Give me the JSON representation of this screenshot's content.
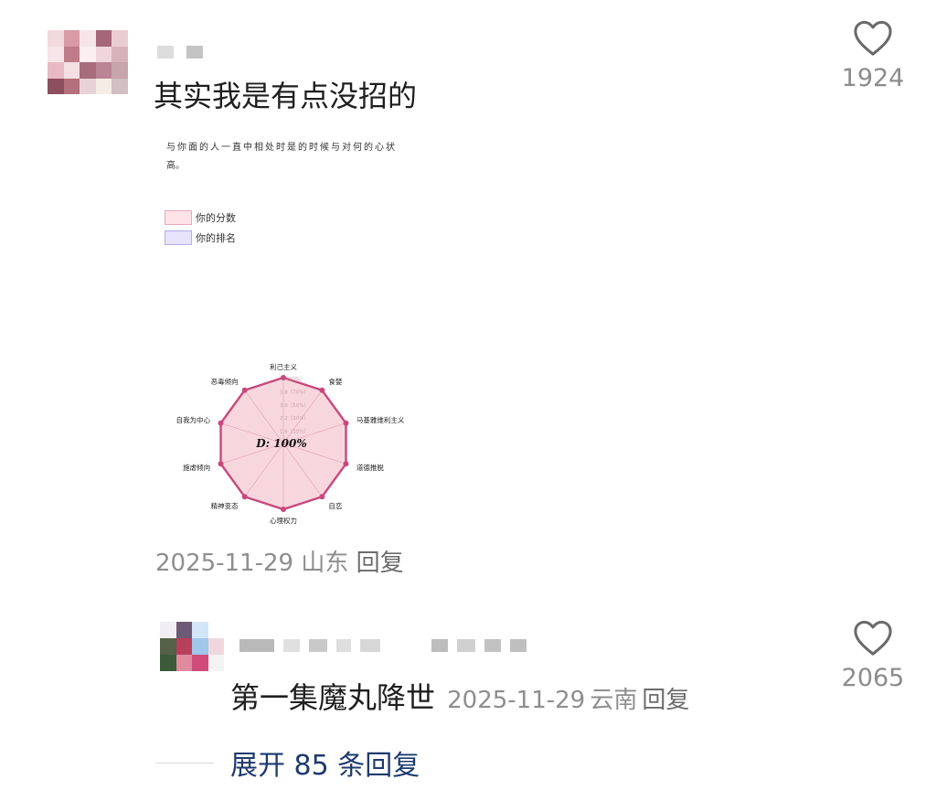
{
  "comments": [
    {
      "text": "其实我是有点没招的",
      "date": "2025-11-29",
      "location": "山东",
      "reply_label": "回复",
      "likes": "1924",
      "attachment": {
        "caption_line1": "与你面的人一直中相处时是的时候与对何的心状",
        "caption_line2": "高。",
        "legend": [
          "你的分数",
          "你的排名"
        ],
        "center_label": "D: 100%",
        "ring_labels": [
          "1.6（10%）",
          "2.2（30%）",
          "3.0（50%）",
          "5.8（70%）",
          "（90%）"
        ],
        "axes": [
          "利己主义",
          "食婪",
          "马基雅维利主义",
          "道德推脱",
          "自恋",
          "心理权力",
          "精神变态",
          "施虐倾向",
          "自我为中心",
          "恶毒倾向"
        ],
        "colors": {
          "fill": "#f7d7dd",
          "stroke": "#c9487c",
          "dot": "#c9487c",
          "grid": "#e7a9b8"
        }
      }
    },
    {
      "text": "第一集魔丸降世",
      "date": "2025-11-29",
      "location": "云南",
      "reply_label": "回复",
      "likes": "2065"
    }
  ],
  "expand": {
    "label": "展开 85 条回复"
  },
  "icons": {
    "like": "heart-outline-icon"
  }
}
